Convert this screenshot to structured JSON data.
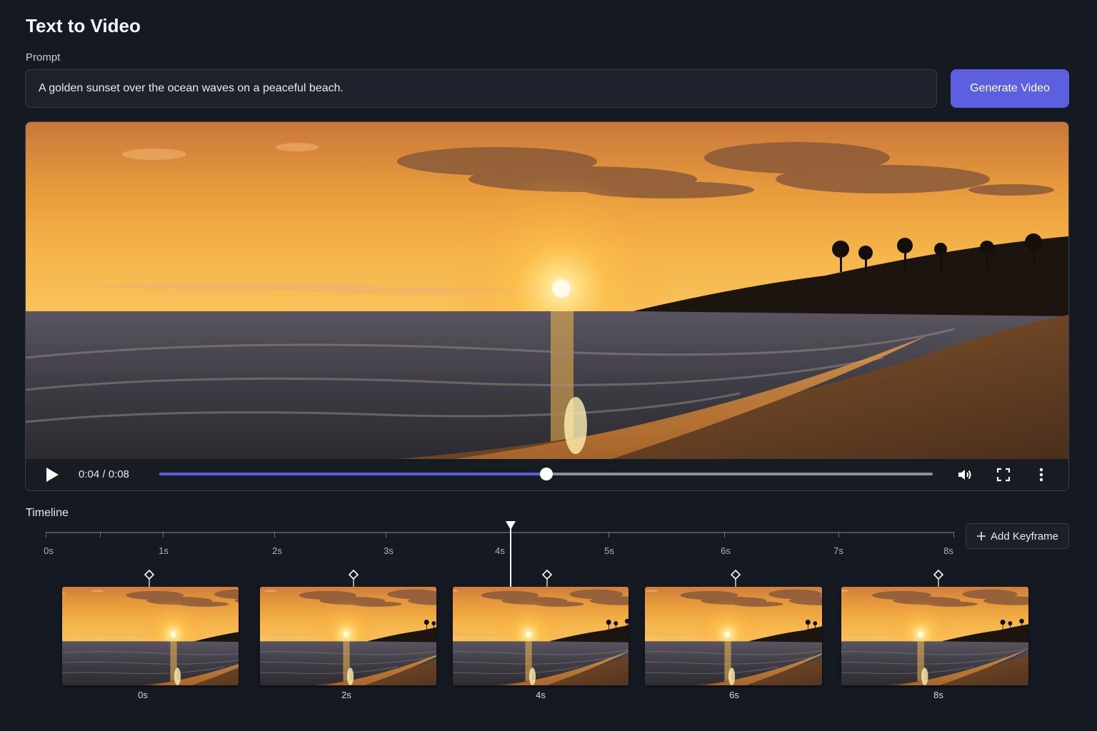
{
  "page": {
    "title": "Text to Video"
  },
  "prompt": {
    "label": "Prompt",
    "value": "A golden sunset over the ocean waves on a peaceful beach.",
    "generate_label": "Generate Video"
  },
  "player": {
    "time_display": "0:04 / 0:08",
    "progress_fraction": 0.5,
    "icons": [
      "play-icon",
      "volume-icon",
      "fullscreen-icon",
      "more-vertical-icon"
    ]
  },
  "timeline": {
    "label": "Timeline",
    "ticks": [
      "0s",
      "1s",
      "2s",
      "3s",
      "4s",
      "5s",
      "6s",
      "7s",
      "8s"
    ],
    "add_keyframe_label": "Add Keyframe",
    "playhead_seconds": 4,
    "keyframes": [
      {
        "label": "0s"
      },
      {
        "label": "2s"
      },
      {
        "label": "4s"
      },
      {
        "label": "6s"
      },
      {
        "label": "8s"
      }
    ]
  },
  "colors": {
    "accent": "#5b5fe0",
    "background": "#151a22",
    "panel": "#1d222c"
  }
}
